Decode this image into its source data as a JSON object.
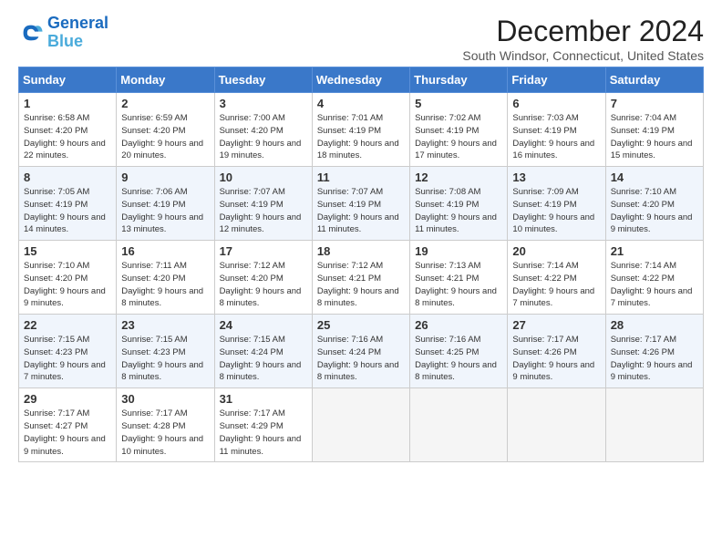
{
  "logo": {
    "line1": "General",
    "line2": "Blue"
  },
  "title": "December 2024",
  "location": "South Windsor, Connecticut, United States",
  "headers": [
    "Sunday",
    "Monday",
    "Tuesday",
    "Wednesday",
    "Thursday",
    "Friday",
    "Saturday"
  ],
  "weeks": [
    [
      {
        "day": "1",
        "sunrise": "6:58 AM",
        "sunset": "4:20 PM",
        "daylight": "9 hours and 22 minutes."
      },
      {
        "day": "2",
        "sunrise": "6:59 AM",
        "sunset": "4:20 PM",
        "daylight": "9 hours and 20 minutes."
      },
      {
        "day": "3",
        "sunrise": "7:00 AM",
        "sunset": "4:20 PM",
        "daylight": "9 hours and 19 minutes."
      },
      {
        "day": "4",
        "sunrise": "7:01 AM",
        "sunset": "4:19 PM",
        "daylight": "9 hours and 18 minutes."
      },
      {
        "day": "5",
        "sunrise": "7:02 AM",
        "sunset": "4:19 PM",
        "daylight": "9 hours and 17 minutes."
      },
      {
        "day": "6",
        "sunrise": "7:03 AM",
        "sunset": "4:19 PM",
        "daylight": "9 hours and 16 minutes."
      },
      {
        "day": "7",
        "sunrise": "7:04 AM",
        "sunset": "4:19 PM",
        "daylight": "9 hours and 15 minutes."
      }
    ],
    [
      {
        "day": "8",
        "sunrise": "7:05 AM",
        "sunset": "4:19 PM",
        "daylight": "9 hours and 14 minutes."
      },
      {
        "day": "9",
        "sunrise": "7:06 AM",
        "sunset": "4:19 PM",
        "daylight": "9 hours and 13 minutes."
      },
      {
        "day": "10",
        "sunrise": "7:07 AM",
        "sunset": "4:19 PM",
        "daylight": "9 hours and 12 minutes."
      },
      {
        "day": "11",
        "sunrise": "7:07 AM",
        "sunset": "4:19 PM",
        "daylight": "9 hours and 11 minutes."
      },
      {
        "day": "12",
        "sunrise": "7:08 AM",
        "sunset": "4:19 PM",
        "daylight": "9 hours and 11 minutes."
      },
      {
        "day": "13",
        "sunrise": "7:09 AM",
        "sunset": "4:19 PM",
        "daylight": "9 hours and 10 minutes."
      },
      {
        "day": "14",
        "sunrise": "7:10 AM",
        "sunset": "4:20 PM",
        "daylight": "9 hours and 9 minutes."
      }
    ],
    [
      {
        "day": "15",
        "sunrise": "7:10 AM",
        "sunset": "4:20 PM",
        "daylight": "9 hours and 9 minutes."
      },
      {
        "day": "16",
        "sunrise": "7:11 AM",
        "sunset": "4:20 PM",
        "daylight": "9 hours and 8 minutes."
      },
      {
        "day": "17",
        "sunrise": "7:12 AM",
        "sunset": "4:20 PM",
        "daylight": "9 hours and 8 minutes."
      },
      {
        "day": "18",
        "sunrise": "7:12 AM",
        "sunset": "4:21 PM",
        "daylight": "9 hours and 8 minutes."
      },
      {
        "day": "19",
        "sunrise": "7:13 AM",
        "sunset": "4:21 PM",
        "daylight": "9 hours and 8 minutes."
      },
      {
        "day": "20",
        "sunrise": "7:14 AM",
        "sunset": "4:22 PM",
        "daylight": "9 hours and 7 minutes."
      },
      {
        "day": "21",
        "sunrise": "7:14 AM",
        "sunset": "4:22 PM",
        "daylight": "9 hours and 7 minutes."
      }
    ],
    [
      {
        "day": "22",
        "sunrise": "7:15 AM",
        "sunset": "4:23 PM",
        "daylight": "9 hours and 7 minutes."
      },
      {
        "day": "23",
        "sunrise": "7:15 AM",
        "sunset": "4:23 PM",
        "daylight": "9 hours and 8 minutes."
      },
      {
        "day": "24",
        "sunrise": "7:15 AM",
        "sunset": "4:24 PM",
        "daylight": "9 hours and 8 minutes."
      },
      {
        "day": "25",
        "sunrise": "7:16 AM",
        "sunset": "4:24 PM",
        "daylight": "9 hours and 8 minutes."
      },
      {
        "day": "26",
        "sunrise": "7:16 AM",
        "sunset": "4:25 PM",
        "daylight": "9 hours and 8 minutes."
      },
      {
        "day": "27",
        "sunrise": "7:17 AM",
        "sunset": "4:26 PM",
        "daylight": "9 hours and 9 minutes."
      },
      {
        "day": "28",
        "sunrise": "7:17 AM",
        "sunset": "4:26 PM",
        "daylight": "9 hours and 9 minutes."
      }
    ],
    [
      {
        "day": "29",
        "sunrise": "7:17 AM",
        "sunset": "4:27 PM",
        "daylight": "9 hours and 9 minutes."
      },
      {
        "day": "30",
        "sunrise": "7:17 AM",
        "sunset": "4:28 PM",
        "daylight": "9 hours and 10 minutes."
      },
      {
        "day": "31",
        "sunrise": "7:17 AM",
        "sunset": "4:29 PM",
        "daylight": "9 hours and 11 minutes."
      },
      null,
      null,
      null,
      null
    ]
  ]
}
